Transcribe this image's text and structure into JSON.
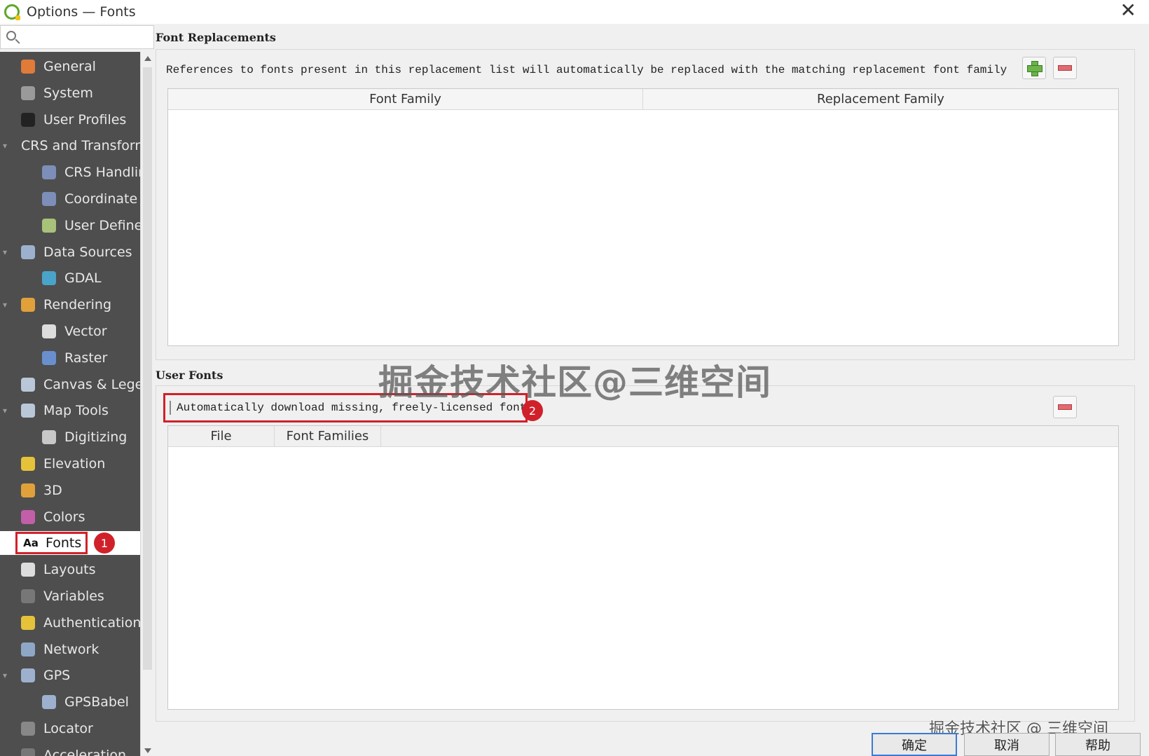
{
  "window": {
    "title": "Options — Fonts",
    "close_glyph": "✕"
  },
  "search": {
    "placeholder": ""
  },
  "sidebar": {
    "items": [
      {
        "label": "General",
        "level": 0,
        "icon": "general-icon",
        "color": "#e07b39"
      },
      {
        "label": "System",
        "level": 0,
        "icon": "system-icon",
        "color": "#9a9a9a"
      },
      {
        "label": "User Profiles",
        "level": 0,
        "icon": "user-icon",
        "color": "#222222"
      },
      {
        "label": "CRS and Transforms",
        "level": 0,
        "icon": "",
        "expanded": true
      },
      {
        "label": "CRS Handling",
        "level": 1,
        "icon": "globe-icon",
        "color": "#7d8fb8"
      },
      {
        "label": "Coordinate Transforms",
        "level": 1,
        "icon": "globe-icon",
        "color": "#7d8fb8"
      },
      {
        "label": "User Defined CRS",
        "level": 1,
        "icon": "globe-icon",
        "color": "#a8c27a"
      },
      {
        "label": "Data Sources",
        "level": 0,
        "icon": "table-icon",
        "color": "#9db1cf",
        "expanded": true
      },
      {
        "label": "GDAL",
        "level": 1,
        "icon": "gdal-icon",
        "color": "#4aa3c8"
      },
      {
        "label": "Rendering",
        "level": 0,
        "icon": "brush-icon",
        "color": "#e0a13a",
        "expanded": true
      },
      {
        "label": "Vector",
        "level": 1,
        "icon": "vector-icon",
        "color": "#dddddd"
      },
      {
        "label": "Raster",
        "level": 1,
        "icon": "raster-icon",
        "color": "#6a8fcf"
      },
      {
        "label": "Canvas & Legend",
        "level": 0,
        "icon": "canvas-icon",
        "color": "#b9c7d8"
      },
      {
        "label": "Map Tools",
        "level": 0,
        "icon": "map-tools-icon",
        "color": "#b9c7d8",
        "expanded": true
      },
      {
        "label": "Digitizing",
        "level": 1,
        "icon": "digitizing-icon",
        "color": "#c8c8c8"
      },
      {
        "label": "Elevation",
        "level": 0,
        "icon": "elevation-icon",
        "color": "#e6c23a"
      },
      {
        "label": "3D",
        "level": 0,
        "icon": "cube-icon",
        "color": "#e0a13a"
      },
      {
        "label": "Colors",
        "level": 0,
        "icon": "palette-icon",
        "color": "#c25fa8"
      },
      {
        "label": "Fonts",
        "level": 0,
        "icon": "fonts-icon",
        "icon_text": "Aa",
        "selected": true,
        "badge": "1"
      },
      {
        "label": "Layouts",
        "level": 0,
        "icon": "layouts-icon",
        "color": "#dddddd"
      },
      {
        "label": "Variables",
        "level": 0,
        "icon": "variables-icon",
        "color": "#777777"
      },
      {
        "label": "Authentication",
        "level": 0,
        "icon": "lock-icon",
        "color": "#e6c23a"
      },
      {
        "label": "Network",
        "level": 0,
        "icon": "network-icon",
        "color": "#8fa7c7"
      },
      {
        "label": "GPS",
        "level": 0,
        "icon": "gps-icon",
        "color": "#9db1cf",
        "expanded": true
      },
      {
        "label": "GPSBabel",
        "level": 1,
        "icon": "gps-icon",
        "color": "#9db1cf"
      },
      {
        "label": "Locator",
        "level": 0,
        "icon": "search-icon",
        "color": "#888888"
      },
      {
        "label": "Acceleration",
        "level": 0,
        "icon": "acceleration-icon",
        "color": "#777777"
      }
    ]
  },
  "font_replacements": {
    "title": "Font Replacements",
    "description": "References to fonts present in this replacement list will automatically be replaced with the matching replacement font family",
    "columns": [
      "Font Family",
      "Replacement Family"
    ],
    "rows": []
  },
  "user_fonts": {
    "title": "User Fonts",
    "checkbox_label": "Automatically download missing, freely-licensed fonts",
    "checkbox_checked": false,
    "badge": "2",
    "columns": [
      "File",
      "Font Families"
    ],
    "rows": []
  },
  "watermark": {
    "main": "掘金技术社区@三维空间",
    "corner": "掘金技术社区 @ 三维空间"
  },
  "buttons": {
    "ok": "确定",
    "cancel": "取消",
    "help": "帮助"
  },
  "colors": {
    "sidebar_bg": "#4e4e4e",
    "highlight_red": "#d0212a",
    "add_green": "#6bb34a",
    "remove_red": "#e06b72"
  }
}
